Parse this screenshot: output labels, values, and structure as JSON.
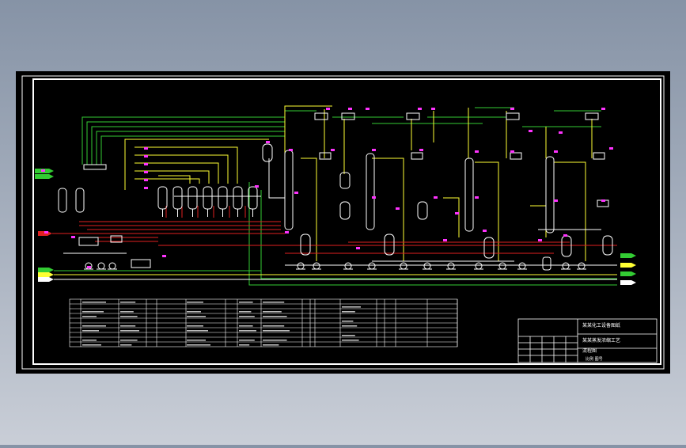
{
  "drawing": {
    "background": "#000000",
    "frame_color": "#ffffff",
    "colors": {
      "green": "#33cc33",
      "yellow": "#ffff33",
      "red": "#e02020",
      "white": "#ffffff",
      "magenta": "#ff33ff",
      "cyan": "#33ffff"
    },
    "title_block_lines": [
      "某某化工设备图纸",
      "某某蒸发浓缩工艺",
      "流程图"
    ],
    "title_block_footer": "比例  图号"
  }
}
